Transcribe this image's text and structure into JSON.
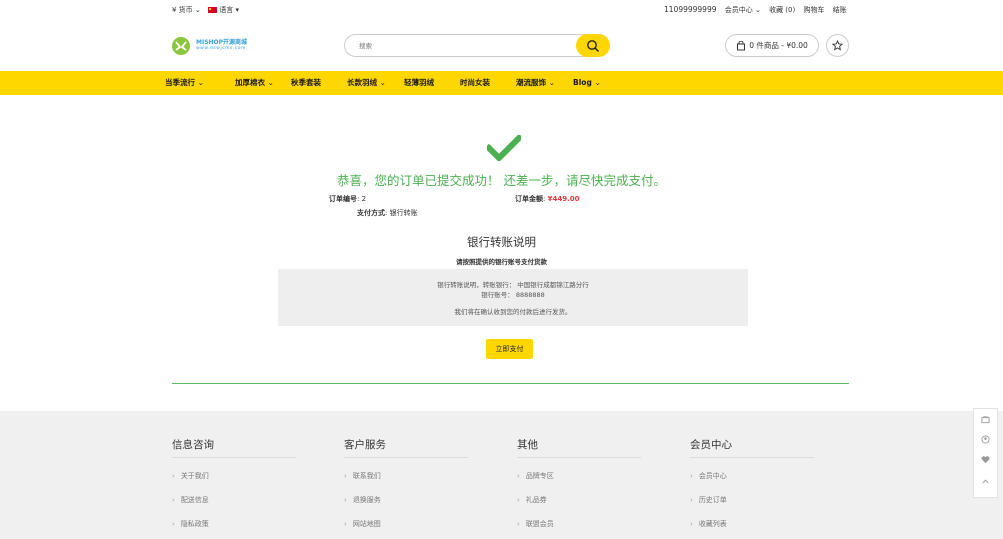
{
  "topbar": {
    "currency": "¥ 货币",
    "language": "语言",
    "phone": "11099999999",
    "member_center": "会员中心",
    "favorites": "收藏 (0)",
    "cart": "购物车",
    "checkout": "结账"
  },
  "header": {
    "logo_name": "MISHOP开源商城",
    "logo_url": "www.dswjcms.com",
    "search_placeholder": "搜索",
    "cart_summary": "0 件商品 - ¥0.00"
  },
  "nav": {
    "items": [
      {
        "label": "当季流行",
        "caret": "⌄"
      },
      {
        "label": "加厚棉衣",
        "caret": "⌄"
      },
      {
        "label": "秋季套装",
        "caret": ""
      },
      {
        "label": "长款羽绒",
        "caret": "⌄"
      },
      {
        "label": "轻薄羽绒",
        "caret": ""
      },
      {
        "label": "时尚女装",
        "caret": ""
      },
      {
        "label": "潮流服饰",
        "caret": "⌄"
      },
      {
        "label": "Blog",
        "caret": "⌄"
      }
    ]
  },
  "order": {
    "success_message": "恭喜，您的订单已提交成功！ 还差一步，请尽快完成支付。",
    "order_no_label": "订单编号",
    "order_no_value": "2",
    "amount_label": "订单金额",
    "amount_value": "¥449.00",
    "pay_method_label": "支付方式",
    "pay_method_value": "银行转账"
  },
  "bank": {
    "title": "银行转账说明",
    "subtitle": "请按照提供的银行账号支付货款",
    "bank_line_label": "银行转账说明，转账银行：",
    "bank_line_value": "中国银行成都锦江路分行",
    "account_label": "银行账号：",
    "account_value": "8888888",
    "note": "我们将在确认收到您的付款后进行发货。",
    "pay_button": "立即支付"
  },
  "footer": {
    "columns": [
      {
        "title": "信息咨询",
        "links": [
          "关于我们",
          "配送信息",
          "隐私政策"
        ]
      },
      {
        "title": "客户服务",
        "links": [
          "联系我们",
          "退换服务",
          "网站地图"
        ]
      },
      {
        "title": "其他",
        "links": [
          "品牌专区",
          "礼品券",
          "联盟会员"
        ]
      },
      {
        "title": "会员中心",
        "links": [
          "会员中心",
          "历史订单",
          "收藏列表"
        ]
      }
    ]
  },
  "colors": {
    "accent": "#ffd700",
    "success": "#4caf50",
    "price": "#e4393c"
  }
}
